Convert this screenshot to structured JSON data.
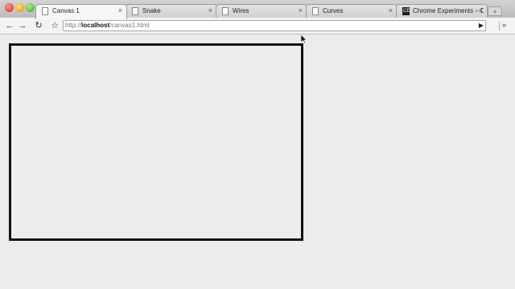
{
  "browser": {
    "tabs": [
      {
        "label": "Canvas 1",
        "icon": "page-icon",
        "active": true
      },
      {
        "label": "Snake",
        "icon": "page-icon",
        "active": false
      },
      {
        "label": "Wires",
        "icon": "page-icon",
        "active": false
      },
      {
        "label": "Curves",
        "icon": "page-icon",
        "active": false
      },
      {
        "label": "Chrome Experiments – Do",
        "icon": "chrome-experiments-icon",
        "icon_text": "CE",
        "active": false
      }
    ],
    "close_glyph": "×",
    "toolbar": {
      "back_glyph": "←",
      "forward_glyph": "→",
      "reload_glyph": "↻",
      "star_glyph": "☆",
      "go_glyph": "▶",
      "more_glyph": "»"
    },
    "address": {
      "scheme": "http://",
      "host": "localhost",
      "path": "/canvas1.html"
    }
  },
  "colors": {
    "page_background": "#ececea",
    "canvas_border": "#111111"
  }
}
